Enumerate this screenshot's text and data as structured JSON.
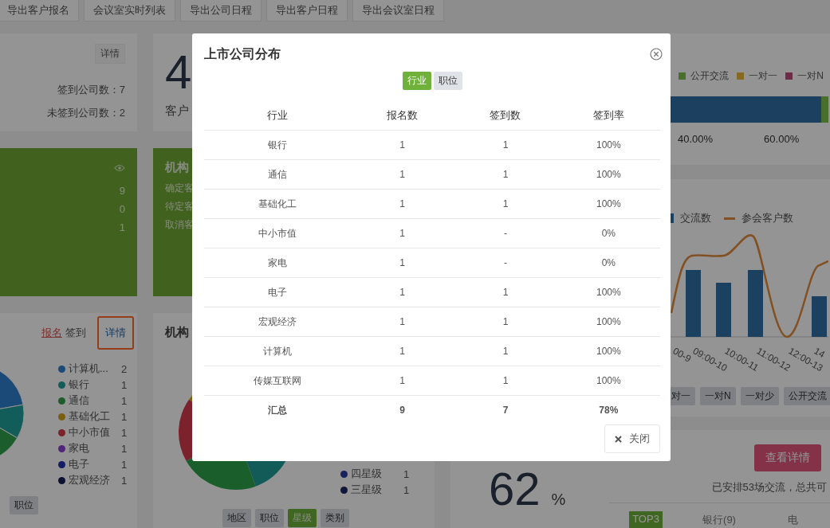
{
  "nav_buttons": [
    "导出客户报名",
    "会议室实时列表",
    "导出公司日程",
    "导出客户日程",
    "导出会议室日程"
  ],
  "signin_card": {
    "detail_button": "详情",
    "stats": [
      "签到公司数：7",
      "未签到公司数：2"
    ]
  },
  "customer_card": {
    "number": "4",
    "label": "客户"
  },
  "exchange_share_card": {
    "legend": [
      {
        "label": "公开交流",
        "color": "#486f2c"
      },
      {
        "label": "一对一",
        "color": "#876a22"
      },
      {
        "label": "一对N",
        "color": "#712849"
      }
    ],
    "tick_labels": [
      "40.00%",
      "60.00%"
    ]
  },
  "green_stats_card": {
    "values": [
      "9",
      "0",
      "1"
    ]
  },
  "institution_customer_card": {
    "title": "机构",
    "lines": [
      "确定客",
      "待定客",
      "取消客"
    ]
  },
  "timeslot_card": {
    "legend": [
      {
        "label": "交流数",
        "kind": "bar"
      },
      {
        "label": "参会客户数",
        "kind": "line"
      }
    ],
    "x_labels": [
      "00-9",
      "09:00-10",
      "10:00-11",
      "11:00-12",
      "12:00-13",
      "14"
    ],
    "filters": [
      "对一",
      "一对N",
      "一对少",
      "公开交流"
    ]
  },
  "industry_card": {
    "tabs": [
      {
        "label": "报名",
        "selected": true
      },
      {
        "label": "签到",
        "selected": false
      }
    ],
    "detail_link": {
      "label": "详情",
      "highlighted": true
    },
    "legend": [
      {
        "label": "计算机...",
        "count": "2",
        "color": "#1b4a79"
      },
      {
        "label": "银行",
        "count": "1",
        "color": "#125c59"
      },
      {
        "label": "通信",
        "count": "1",
        "color": "#1b5e2b"
      },
      {
        "label": "基础化工",
        "count": "1",
        "color": "#7c5e10"
      },
      {
        "label": "中小市值",
        "count": "1",
        "color": "#7c222d"
      },
      {
        "label": "家电",
        "count": "1",
        "color": "#532578"
      },
      {
        "label": "电子",
        "count": "1",
        "color": "#131c66"
      },
      {
        "label": "宏观经济",
        "count": "1",
        "color": "#0c1031"
      }
    ],
    "buttons": [
      {
        "label": "职位",
        "selected": false
      }
    ]
  },
  "institution_star_card": {
    "title": "机构",
    "legend": [
      {
        "label": "四星级",
        "count": "1",
        "color": "#18225c"
      },
      {
        "label": "三星级",
        "count": "1",
        "color": "#11173b"
      }
    ],
    "buttons": [
      {
        "label": "地区",
        "selected": false
      },
      {
        "label": "职位",
        "selected": false
      },
      {
        "label": "星级",
        "selected": true
      },
      {
        "label": "类别",
        "selected": false
      }
    ]
  },
  "rate_card": {
    "value": "62",
    "unit": "%"
  },
  "schedule_card": {
    "button": "查看详情",
    "summary": "已安排53场交流，总共可",
    "tabs": [
      {
        "label": "TOP3",
        "selected": true
      },
      {
        "label": "银行(9)",
        "selected": false
      },
      {
        "label": "电",
        "selected": false
      }
    ]
  },
  "modal": {
    "title": "上市公司分布",
    "toggles": [
      {
        "label": "行业",
        "selected": true
      },
      {
        "label": "职位",
        "selected": false
      }
    ],
    "columns": [
      "行业",
      "报名数",
      "签到数",
      "签到率"
    ],
    "rows": [
      [
        "银行",
        "1",
        "1",
        "100%"
      ],
      [
        "通信",
        "1",
        "1",
        "100%"
      ],
      [
        "基础化工",
        "1",
        "1",
        "100%"
      ],
      [
        "中小市值",
        "1",
        "-",
        "0%"
      ],
      [
        "家电",
        "1",
        "-",
        "0%"
      ],
      [
        "电子",
        "1",
        "1",
        "100%"
      ],
      [
        "宏观经济",
        "1",
        "1",
        "100%"
      ],
      [
        "计算机",
        "1",
        "1",
        "100%"
      ],
      [
        "传媒互联网",
        "1",
        "1",
        "100%"
      ]
    ],
    "total": [
      "汇总",
      "9",
      "7",
      "78%"
    ],
    "close_button": "关闭"
  }
}
